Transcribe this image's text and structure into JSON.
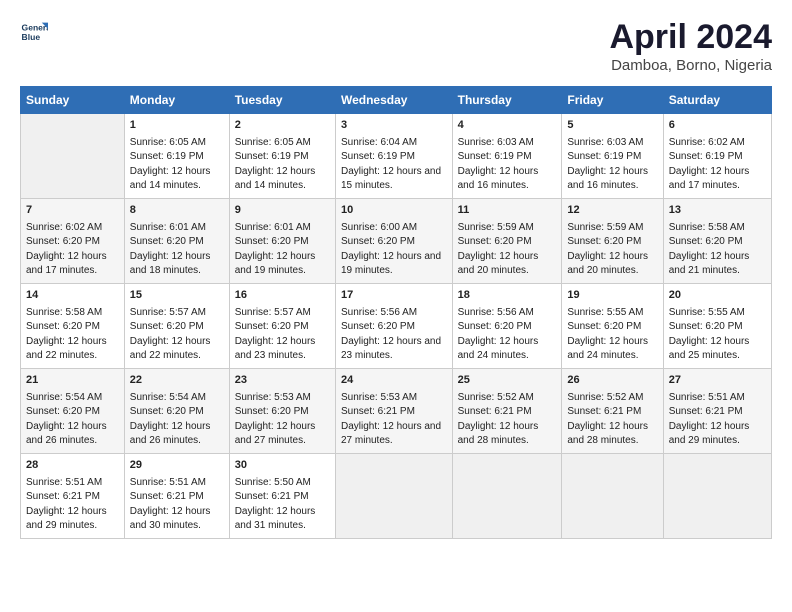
{
  "logo": {
    "line1": "General",
    "line2": "Blue"
  },
  "title": "April 2024",
  "subtitle": "Damboa, Borno, Nigeria",
  "header": {
    "bg_color": "#2f6eb5",
    "days": [
      "Sunday",
      "Monday",
      "Tuesday",
      "Wednesday",
      "Thursday",
      "Friday",
      "Saturday"
    ]
  },
  "weeks": [
    [
      {
        "day": "",
        "sunrise": "",
        "sunset": "",
        "daylight": ""
      },
      {
        "day": "1",
        "sunrise": "Sunrise: 6:05 AM",
        "sunset": "Sunset: 6:19 PM",
        "daylight": "Daylight: 12 hours and 14 minutes."
      },
      {
        "day": "2",
        "sunrise": "Sunrise: 6:05 AM",
        "sunset": "Sunset: 6:19 PM",
        "daylight": "Daylight: 12 hours and 14 minutes."
      },
      {
        "day": "3",
        "sunrise": "Sunrise: 6:04 AM",
        "sunset": "Sunset: 6:19 PM",
        "daylight": "Daylight: 12 hours and 15 minutes."
      },
      {
        "day": "4",
        "sunrise": "Sunrise: 6:03 AM",
        "sunset": "Sunset: 6:19 PM",
        "daylight": "Daylight: 12 hours and 16 minutes."
      },
      {
        "day": "5",
        "sunrise": "Sunrise: 6:03 AM",
        "sunset": "Sunset: 6:19 PM",
        "daylight": "Daylight: 12 hours and 16 minutes."
      },
      {
        "day": "6",
        "sunrise": "Sunrise: 6:02 AM",
        "sunset": "Sunset: 6:19 PM",
        "daylight": "Daylight: 12 hours and 17 minutes."
      }
    ],
    [
      {
        "day": "7",
        "sunrise": "Sunrise: 6:02 AM",
        "sunset": "Sunset: 6:20 PM",
        "daylight": "Daylight: 12 hours and 17 minutes."
      },
      {
        "day": "8",
        "sunrise": "Sunrise: 6:01 AM",
        "sunset": "Sunset: 6:20 PM",
        "daylight": "Daylight: 12 hours and 18 minutes."
      },
      {
        "day": "9",
        "sunrise": "Sunrise: 6:01 AM",
        "sunset": "Sunset: 6:20 PM",
        "daylight": "Daylight: 12 hours and 19 minutes."
      },
      {
        "day": "10",
        "sunrise": "Sunrise: 6:00 AM",
        "sunset": "Sunset: 6:20 PM",
        "daylight": "Daylight: 12 hours and 19 minutes."
      },
      {
        "day": "11",
        "sunrise": "Sunrise: 5:59 AM",
        "sunset": "Sunset: 6:20 PM",
        "daylight": "Daylight: 12 hours and 20 minutes."
      },
      {
        "day": "12",
        "sunrise": "Sunrise: 5:59 AM",
        "sunset": "Sunset: 6:20 PM",
        "daylight": "Daylight: 12 hours and 20 minutes."
      },
      {
        "day": "13",
        "sunrise": "Sunrise: 5:58 AM",
        "sunset": "Sunset: 6:20 PM",
        "daylight": "Daylight: 12 hours and 21 minutes."
      }
    ],
    [
      {
        "day": "14",
        "sunrise": "Sunrise: 5:58 AM",
        "sunset": "Sunset: 6:20 PM",
        "daylight": "Daylight: 12 hours and 22 minutes."
      },
      {
        "day": "15",
        "sunrise": "Sunrise: 5:57 AM",
        "sunset": "Sunset: 6:20 PM",
        "daylight": "Daylight: 12 hours and 22 minutes."
      },
      {
        "day": "16",
        "sunrise": "Sunrise: 5:57 AM",
        "sunset": "Sunset: 6:20 PM",
        "daylight": "Daylight: 12 hours and 23 minutes."
      },
      {
        "day": "17",
        "sunrise": "Sunrise: 5:56 AM",
        "sunset": "Sunset: 6:20 PM",
        "daylight": "Daylight: 12 hours and 23 minutes."
      },
      {
        "day": "18",
        "sunrise": "Sunrise: 5:56 AM",
        "sunset": "Sunset: 6:20 PM",
        "daylight": "Daylight: 12 hours and 24 minutes."
      },
      {
        "day": "19",
        "sunrise": "Sunrise: 5:55 AM",
        "sunset": "Sunset: 6:20 PM",
        "daylight": "Daylight: 12 hours and 24 minutes."
      },
      {
        "day": "20",
        "sunrise": "Sunrise: 5:55 AM",
        "sunset": "Sunset: 6:20 PM",
        "daylight": "Daylight: 12 hours and 25 minutes."
      }
    ],
    [
      {
        "day": "21",
        "sunrise": "Sunrise: 5:54 AM",
        "sunset": "Sunset: 6:20 PM",
        "daylight": "Daylight: 12 hours and 26 minutes."
      },
      {
        "day": "22",
        "sunrise": "Sunrise: 5:54 AM",
        "sunset": "Sunset: 6:20 PM",
        "daylight": "Daylight: 12 hours and 26 minutes."
      },
      {
        "day": "23",
        "sunrise": "Sunrise: 5:53 AM",
        "sunset": "Sunset: 6:20 PM",
        "daylight": "Daylight: 12 hours and 27 minutes."
      },
      {
        "day": "24",
        "sunrise": "Sunrise: 5:53 AM",
        "sunset": "Sunset: 6:21 PM",
        "daylight": "Daylight: 12 hours and 27 minutes."
      },
      {
        "day": "25",
        "sunrise": "Sunrise: 5:52 AM",
        "sunset": "Sunset: 6:21 PM",
        "daylight": "Daylight: 12 hours and 28 minutes."
      },
      {
        "day": "26",
        "sunrise": "Sunrise: 5:52 AM",
        "sunset": "Sunset: 6:21 PM",
        "daylight": "Daylight: 12 hours and 28 minutes."
      },
      {
        "day": "27",
        "sunrise": "Sunrise: 5:51 AM",
        "sunset": "Sunset: 6:21 PM",
        "daylight": "Daylight: 12 hours and 29 minutes."
      }
    ],
    [
      {
        "day": "28",
        "sunrise": "Sunrise: 5:51 AM",
        "sunset": "Sunset: 6:21 PM",
        "daylight": "Daylight: 12 hours and 29 minutes."
      },
      {
        "day": "29",
        "sunrise": "Sunrise: 5:51 AM",
        "sunset": "Sunset: 6:21 PM",
        "daylight": "Daylight: 12 hours and 30 minutes."
      },
      {
        "day": "30",
        "sunrise": "Sunrise: 5:50 AM",
        "sunset": "Sunset: 6:21 PM",
        "daylight": "Daylight: 12 hours and 31 minutes."
      },
      {
        "day": "",
        "sunrise": "",
        "sunset": "",
        "daylight": ""
      },
      {
        "day": "",
        "sunrise": "",
        "sunset": "",
        "daylight": ""
      },
      {
        "day": "",
        "sunrise": "",
        "sunset": "",
        "daylight": ""
      },
      {
        "day": "",
        "sunrise": "",
        "sunset": "",
        "daylight": ""
      }
    ]
  ]
}
